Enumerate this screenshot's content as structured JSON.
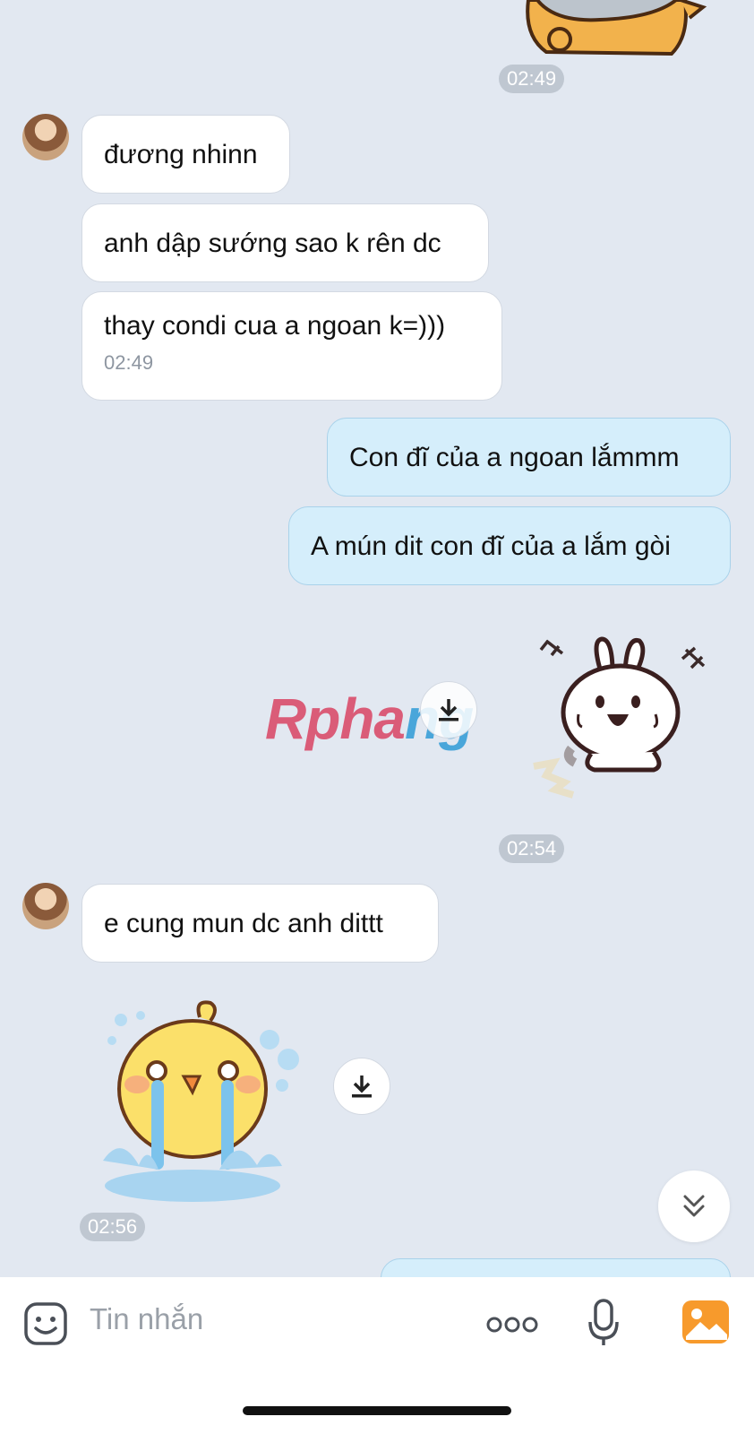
{
  "messages": {
    "time_1": "02:49",
    "m1": "đương nhinn",
    "m2": "anh dập sướng sao k rên dc",
    "m3": "thay condi cua a ngoan k=)))",
    "m3_time": "02:49",
    "o1": "Con đĩ của a ngoan lắmmm",
    "o2": "A mún dit con đĩ của a lắm gòi",
    "time_2": "02:54",
    "m4": "e cung mun dc anh dittt",
    "time_3": "02:56"
  },
  "watermark": {
    "part1": "Rpha",
    "part2": "ng"
  },
  "composer": {
    "placeholder": "Tin nhắn"
  },
  "icons": [
    "emoji-icon",
    "more-icon",
    "microphone-icon",
    "gallery-icon",
    "download-icon",
    "chevrons-down-icon"
  ],
  "colors": {
    "background": "#e2e8f1",
    "incoming_bubble": "#ffffff",
    "outgoing_bubble": "#d5eefb",
    "gallery_accent": "#f79a2c"
  }
}
